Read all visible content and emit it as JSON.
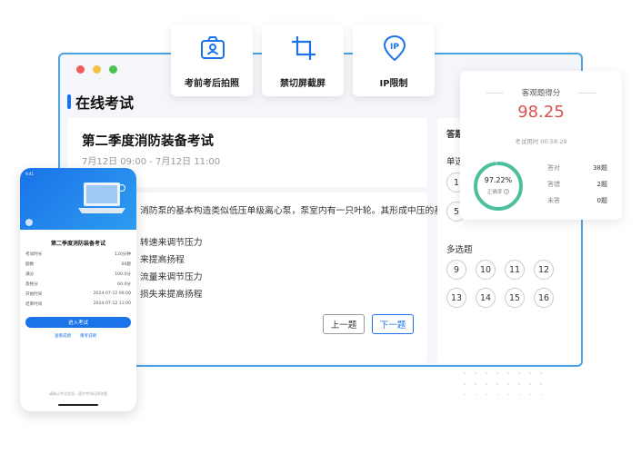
{
  "features": [
    {
      "label": "考前考后拍照",
      "icon": "camera-user-icon"
    },
    {
      "label": "禁切屏截屏",
      "icon": "crop-icon"
    },
    {
      "label": "IP限制",
      "icon": "ip-location-icon"
    }
  ],
  "app": {
    "title": "在线考试"
  },
  "exam": {
    "title": "第二季度消防装备考试",
    "time": "7月12日 09:00 - 7月12日 11:00"
  },
  "question": {
    "lines": [
      "消防泵的基本构造类似低压单级离心泵，泵室内有一只叶轮。其形成中压的基本"
    ],
    "options": [
      "转速来调节压力",
      "来提高扬程",
      "流量来调节压力",
      "损失来提高扬程"
    ]
  },
  "nav": {
    "prev": "上一题",
    "next": "下一题"
  },
  "sheet": {
    "title": "答题",
    "single_label": "单选",
    "single_visible": [
      "1",
      "5"
    ],
    "multi_label": "多选题",
    "multi": [
      "9",
      "10",
      "11",
      "12",
      "13",
      "14",
      "15",
      "16"
    ]
  },
  "score": {
    "title": "客观题得分",
    "value": "98.25",
    "time": "考试用时 00:58:29",
    "rate": "97.22%",
    "rate_label": "正确率",
    "rate_fraction": 0.9722,
    "stats": [
      {
        "label": "答对",
        "value": "38题"
      },
      {
        "label": "答错",
        "value": "2题"
      },
      {
        "label": "未答",
        "value": "0题"
      }
    ]
  },
  "phone": {
    "exam_title": "第二季度消防装备考试",
    "rows": [
      {
        "k": "考试时长",
        "v": "120分钟"
      },
      {
        "k": "题数",
        "v": "60题"
      },
      {
        "k": "满分",
        "v": "100.0分"
      },
      {
        "k": "及格分",
        "v": "60.0分"
      },
      {
        "k": "开始时间",
        "v": "2024-07-12 09:00"
      },
      {
        "k": "结束时间",
        "v": "2024-07-12 11:00"
      }
    ],
    "enter": "进入考试",
    "link1": "查看成绩",
    "link2": "重考说明",
    "footer": "请确认考试信息，遵守考场纪律答题"
  },
  "colors": {
    "accent": "#1a73e8",
    "score": "#d9534f",
    "ring": "#4cbf9f"
  }
}
